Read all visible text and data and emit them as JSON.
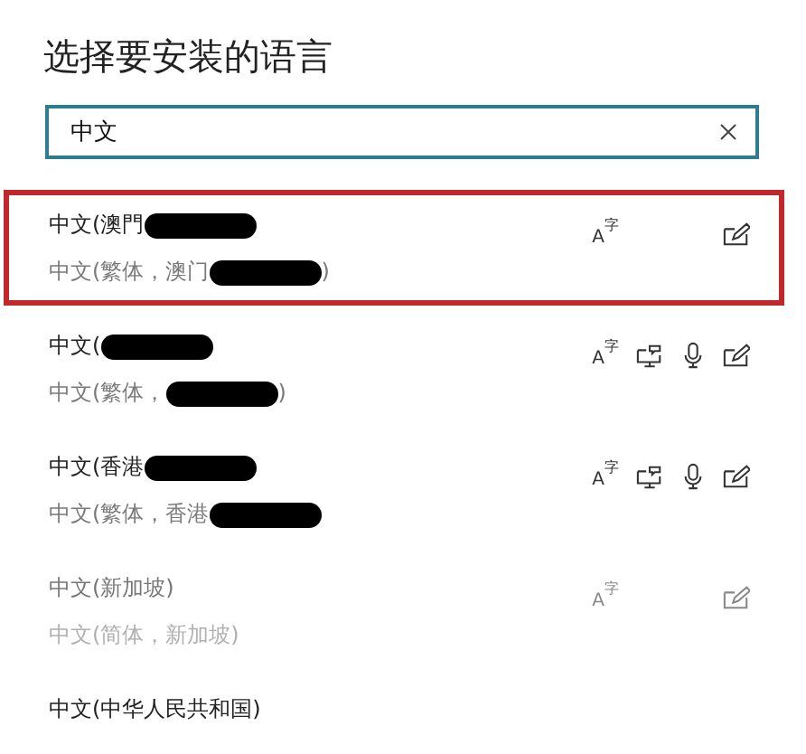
{
  "title": "选择要安装的语言",
  "search": {
    "value": "中文"
  },
  "languages": [
    {
      "name": "中文(澳門",
      "name_redacted": true,
      "detail": "中文(繁体，澳门",
      "detail_redacted": true,
      "detail_after": ")",
      "highlighted": true,
      "disabled": false,
      "features": [
        {
          "kind": "display",
          "base": "A",
          "sup": "字"
        },
        {
          "kind": "handwriting"
        }
      ]
    },
    {
      "name": "中文(",
      "name_redacted": true,
      "detail": "中文(繁体，",
      "detail_redacted": true,
      "detail_after": ")",
      "highlighted": false,
      "disabled": false,
      "features": [
        {
          "kind": "display",
          "base": "A",
          "sup": "字"
        },
        {
          "kind": "text_to_speech"
        },
        {
          "kind": "speech"
        },
        {
          "kind": "handwriting"
        }
      ]
    },
    {
      "name": "中文(香港",
      "name_redacted": true,
      "detail": "中文(繁体，香港",
      "detail_redacted": true,
      "highlighted": false,
      "disabled": false,
      "features": [
        {
          "kind": "display",
          "base": "A",
          "sup": "字"
        },
        {
          "kind": "text_to_speech"
        },
        {
          "kind": "speech"
        },
        {
          "kind": "handwriting"
        }
      ]
    },
    {
      "name": "中文(新加坡)",
      "detail": "中文(简体，新加坡)",
      "highlighted": false,
      "disabled": true,
      "features": [
        {
          "kind": "display",
          "base": "A",
          "sup": "字"
        },
        {
          "kind": "handwriting"
        }
      ]
    },
    {
      "name": "中文(中华人民共和国)",
      "highlighted": false,
      "disabled": false
    }
  ]
}
